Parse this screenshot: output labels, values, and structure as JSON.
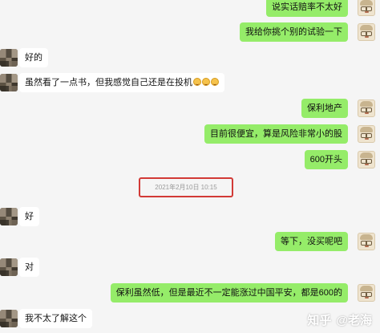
{
  "messages": [
    {
      "side": "out",
      "text": "说实话赔率不太好",
      "avatar": "face-avatar"
    },
    {
      "side": "out",
      "text": "我给你挑个别的试验一下",
      "avatar": "face-avatar"
    },
    {
      "side": "in",
      "text": "好的",
      "avatar": "pixelated-avatar"
    },
    {
      "side": "in",
      "text": "虽然看了一点书，但我感觉自己还是在投机",
      "emoji_count": 3,
      "avatar": "pixelated-avatar"
    },
    {
      "side": "out",
      "text": "保利地产",
      "avatar": "face-avatar"
    },
    {
      "side": "out",
      "text": "目前很便宜，算是风险非常小的股",
      "avatar": "face-avatar"
    },
    {
      "side": "out",
      "text": "600开头",
      "avatar": "face-avatar"
    },
    {
      "side": "in",
      "text": "好",
      "avatar": "pixelated-avatar"
    },
    {
      "side": "out",
      "text": "等下，没买呢吧",
      "avatar": "face-avatar"
    },
    {
      "side": "in",
      "text": "对",
      "avatar": "pixelated-avatar"
    },
    {
      "side": "out",
      "text": "保利虽然低，但是最近不一定能涨过中国平安，都是600的",
      "avatar": "face-avatar"
    },
    {
      "side": "in",
      "text": "我不太了解这个",
      "avatar": "pixelated-avatar"
    }
  ],
  "timestamp": "2021年2月10日 10:15",
  "watermark": {
    "platform": "知乎",
    "separator": "@",
    "author": "老海"
  },
  "colors": {
    "outgoing_bubble": "#95ec69",
    "incoming_bubble": "#ffffff",
    "background": "#f5f5f5",
    "highlight_border": "#d23a36"
  }
}
